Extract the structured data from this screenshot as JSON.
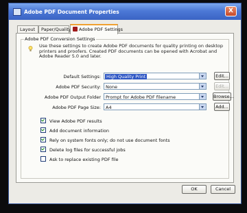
{
  "window": {
    "title": "Adobe PDF Document Properties",
    "close_label": "X"
  },
  "tabs": [
    {
      "label": "Layout"
    },
    {
      "label": "Paper/Quality"
    },
    {
      "label": "Adobe PDF Settings"
    }
  ],
  "group": {
    "label": "Adobe PDF Conversion Settings",
    "description": "Use these settings to create Adobe PDF documents for quality printing on desktop printers and proofers. Created PDF documents can be opened with Acrobat and Adobe Reader 5.0 and later."
  },
  "fields": [
    {
      "label": "Default Settings:",
      "value": "High Quality Print",
      "button": "Edit..."
    },
    {
      "label": "Adobe PDF Security:",
      "value": "None",
      "button": "Edit..."
    },
    {
      "label": "Adobe PDF Output Folder",
      "value": "Prompt for Adobe PDF filename",
      "button": "Browse..."
    },
    {
      "label": "Adobe PDF Page Size:",
      "value": "A4",
      "button": "Add..."
    }
  ],
  "checkboxes": [
    {
      "label": "View Adobe PDF results",
      "checked": true
    },
    {
      "label": "Add document information",
      "checked": true
    },
    {
      "label": "Rely on system fonts only; do not use document fonts",
      "checked": true
    },
    {
      "label": "Delete log files for successful jobs",
      "checked": true
    },
    {
      "label": "Ask to replace existing PDF file",
      "checked": false
    }
  ],
  "footer": {
    "ok": "OK",
    "cancel": "Cancel"
  }
}
